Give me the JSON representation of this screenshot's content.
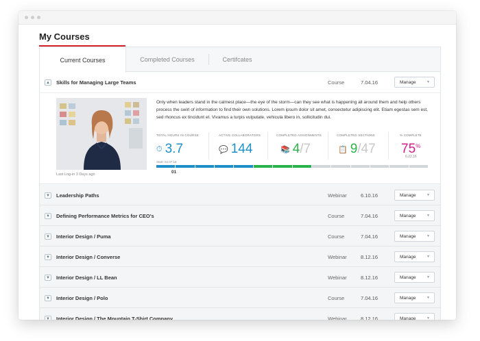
{
  "page": {
    "title": "My Courses"
  },
  "tabs": [
    {
      "label": "Current Courses"
    },
    {
      "label": "Completed Courses"
    },
    {
      "label": "Certifcates"
    }
  ],
  "expanded": {
    "title": "Skills for Managing Large Teams",
    "type": "Course",
    "date": "7.04.16",
    "manage": "Manage",
    "description": "Only when leaders stand in the calmest place—the eye of the storm—can they see what is happening all around them and help others process the swirl of information to find their own solutions. Lorem ipsum dolor sit amet, consectetur adipiscing elit. Etiam egestas sem est, sed rhoncus ex tincidunt et. Vivamus a turpis vulputate, vehicula libero in, sollicitudin dui.",
    "last_login": "Last Log-in 3 Days ago",
    "stats": {
      "hours": {
        "label": "TOTAL HOURS IN COURSE",
        "value": "3.7"
      },
      "collab": {
        "label": "ACTIVE COLLABORATORS",
        "value": "144"
      },
      "assign": {
        "label": "COMPLETED ASSIGNMENTS",
        "done": "4",
        "total": "/7"
      },
      "sections": {
        "label": "COMPLETED SECTIONS",
        "done": "9",
        "total": "/47"
      },
      "complete": {
        "label": "% COMPLETE",
        "value": "75",
        "unit": "%",
        "date": "6.22.16"
      }
    },
    "start_label": "Start: 04.07.16",
    "marker": "01",
    "progress_fraction": 0.57
  },
  "rows": [
    {
      "title": "Leadership Paths",
      "type": "Webinar",
      "date": "6.10.16",
      "manage": "Manage"
    },
    {
      "title": "Defining Performance Metrics for CEO's",
      "type": "Course",
      "date": "7.04.16",
      "manage": "Manage"
    },
    {
      "title": "Interior Design / Puma",
      "type": "Course",
      "date": "7.04.16",
      "manage": "Manage"
    },
    {
      "title": "Interior Design / Converse",
      "type": "Webinar",
      "date": "8.12.16",
      "manage": "Manage"
    },
    {
      "title": "Interior Design / LL Bean",
      "type": "Webinar",
      "date": "8.12.16",
      "manage": "Manage"
    },
    {
      "title": "Interior Design / Polo",
      "type": "Course",
      "date": "7.04.16",
      "manage": "Manage"
    },
    {
      "title": "Interior Design / The Mountain T-Shirt Company",
      "type": "Webinar",
      "date": "8.12.16",
      "manage": "Manage"
    }
  ],
  "colors": {
    "accent": "#d42027",
    "blue": "#1f8fc9",
    "green": "#2bb34b",
    "magenta": "#d41f8c"
  }
}
